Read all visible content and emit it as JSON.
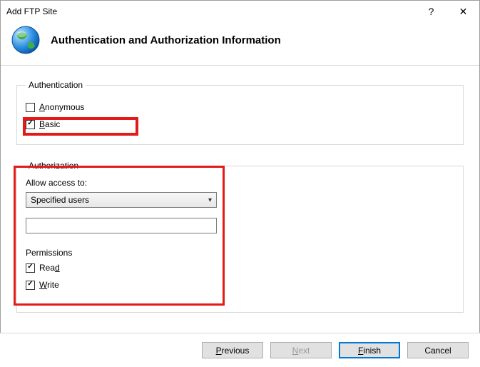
{
  "window": {
    "title": "Add FTP Site",
    "help_symbol": "?",
    "close_symbol": "✕"
  },
  "header": {
    "heading": "Authentication and Authorization Information"
  },
  "authentication": {
    "legend": "Authentication",
    "anonymous": {
      "label_pre": "",
      "label_ul": "A",
      "label_post": "nonymous",
      "checked": false
    },
    "basic": {
      "label_pre": "",
      "label_ul": "B",
      "label_post": "asic",
      "checked": true
    }
  },
  "authorization": {
    "legend": "Authorization",
    "allow_label": "Allow access to:",
    "select_value": "Specified users",
    "input_value": "",
    "permissions_label": "Permissions",
    "read": {
      "label_pre": "Rea",
      "label_ul": "d",
      "label_post": "",
      "checked": true
    },
    "write": {
      "label_pre": "",
      "label_ul": "W",
      "label_post": "rite",
      "checked": true
    }
  },
  "footer": {
    "previous": {
      "pre": "",
      "ul": "P",
      "post": "revious"
    },
    "next": {
      "pre": "",
      "ul": "N",
      "post": "ext"
    },
    "finish": {
      "pre": "",
      "ul": "F",
      "post": "inish"
    },
    "cancel": {
      "pre": "Cancel",
      "ul": "",
      "post": ""
    }
  }
}
